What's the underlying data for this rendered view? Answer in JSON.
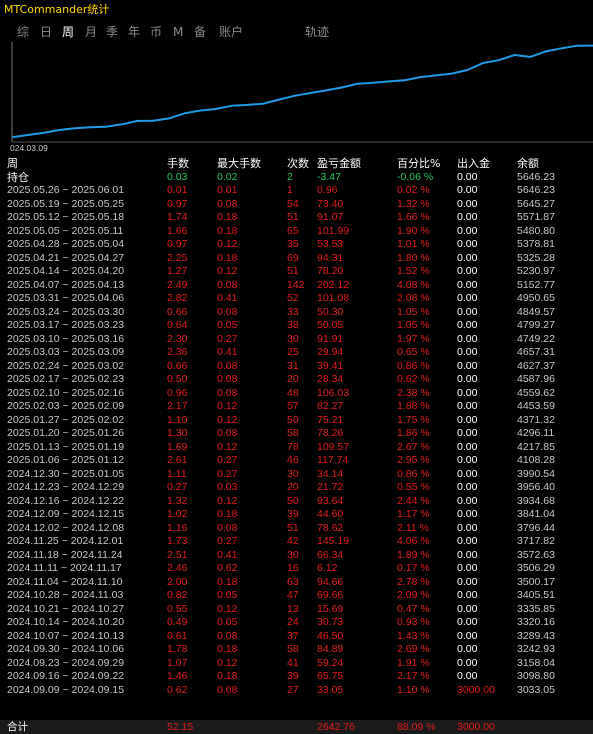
{
  "window": {
    "title": "MTCommander统计"
  },
  "tabs": [
    {
      "label": "综",
      "active": false
    },
    {
      "label": "日",
      "active": false
    },
    {
      "label": "周",
      "active": true
    },
    {
      "label": "月",
      "active": false
    },
    {
      "label": "季",
      "active": false
    },
    {
      "label": "年",
      "active": false
    },
    {
      "label": "币",
      "active": false
    },
    {
      "label": "M",
      "active": false
    },
    {
      "label": "备",
      "active": false
    },
    {
      "label": "账户",
      "active": false
    },
    {
      "label": "轨迹",
      "active": false
    }
  ],
  "chart_data": {
    "type": "line",
    "x_tick_label": "024.03.09",
    "line_color": "#1e9be6",
    "ylim": [
      2900,
      5750
    ],
    "values": [
      3033.05,
      3098.8,
      3158.04,
      3242.93,
      3289.43,
      3320.16,
      3335.85,
      3405.51,
      3500.17,
      3506.29,
      3572.63,
      3717.82,
      3796.44,
      3841.04,
      3934.68,
      3956.4,
      3990.54,
      4108.28,
      4217.85,
      4296.11,
      4371.32,
      4453.59,
      4559.62,
      4587.96,
      4627.37,
      4657.31,
      4749.22,
      4799.27,
      4849.57,
      4950.65,
      5152.77,
      5230.97,
      5378.81,
      5325.28,
      5480.8,
      5571.87,
      5645.27,
      5646.23
    ]
  },
  "table": {
    "headers": [
      "周",
      "手数",
      "最大手数",
      "次数",
      "盈亏金额",
      "百分比%",
      "出入金",
      "余额"
    ],
    "holding": [
      "持仓",
      "0.03",
      "0.02",
      "2",
      "-3.47",
      "-0.06 %",
      "0.00",
      "5646.23"
    ],
    "rows": [
      [
        "2025.05.26 ~ 2025.06.01",
        "0.01",
        "0.01",
        "1",
        "0.96",
        "0.02 %",
        "0.00",
        "5646.23"
      ],
      [
        "2025.05.19 ~ 2025.05.25",
        "0.97",
        "0.08",
        "54",
        "73.40",
        "1.32 %",
        "0.00",
        "5645.27"
      ],
      [
        "2025.05.12 ~ 2025.05.18",
        "1.74",
        "0.18",
        "51",
        "91.07",
        "1.66 %",
        "0.00",
        "5571.87"
      ],
      [
        "2025.05.05 ~ 2025.05.11",
        "1.66",
        "0.18",
        "65",
        "101.99",
        "1.90 %",
        "0.00",
        "5480.80"
      ],
      [
        "2025.04.28 ~ 2025.05.04",
        "0.97",
        "0.12",
        "35",
        "53.53",
        "1.01 %",
        "0.00",
        "5378.81"
      ],
      [
        "2025.04.21 ~ 2025.04.27",
        "2.25",
        "0.18",
        "69",
        "94.31",
        "1.80 %",
        "0.00",
        "5325.28"
      ],
      [
        "2025.04.14 ~ 2025.04.20",
        "1.27",
        "0.12",
        "51",
        "78.20",
        "1.52 %",
        "0.00",
        "5230.97"
      ],
      [
        "2025.04.07 ~ 2025.04.13",
        "2.49",
        "0.08",
        "142",
        "202.12",
        "4.08 %",
        "0.00",
        "5152.77"
      ],
      [
        "2025.03.31 ~ 2025.04.06",
        "2.82",
        "0.41",
        "52",
        "101.08",
        "2.08 %",
        "0.00",
        "4950.65"
      ],
      [
        "2025.03.24 ~ 2025.03.30",
        "0.66",
        "0.08",
        "33",
        "50.30",
        "1.05 %",
        "0.00",
        "4849.57"
      ],
      [
        "2025.03.17 ~ 2025.03.23",
        "0.64",
        "0.05",
        "38",
        "50.05",
        "1.05 %",
        "0.00",
        "4799.27"
      ],
      [
        "2025.03.10 ~ 2025.03.16",
        "2.30",
        "0.27",
        "30",
        "91.91",
        "1.97 %",
        "0.00",
        "4749.22"
      ],
      [
        "2025.03.03 ~ 2025.03.09",
        "2.36",
        "0.41",
        "25",
        "29.94",
        "0.65 %",
        "0.00",
        "4657.31"
      ],
      [
        "2025.02.24 ~ 2025.03.02",
        "0.66",
        "0.08",
        "31",
        "39.41",
        "0.86 %",
        "0.00",
        "4627.37"
      ],
      [
        "2025.02.17 ~ 2025.02.23",
        "0.50",
        "0.08",
        "20",
        "28.34",
        "0.62 %",
        "0.00",
        "4587.96"
      ],
      [
        "2025.02.10 ~ 2025.02.16",
        "0.96",
        "0.08",
        "48",
        "106.03",
        "2.38 %",
        "0.00",
        "4559.62"
      ],
      [
        "2025.02.03 ~ 2025.02.09",
        "2.17",
        "0.12",
        "57",
        "82.27",
        "1.88 %",
        "0.00",
        "4453.59"
      ],
      [
        "2025.01.27 ~ 2025.02.02",
        "1.10",
        "0.12",
        "50",
        "75.21",
        "1.75 %",
        "0.00",
        "4371.32"
      ],
      [
        "2025.01.20 ~ 2025.01.26",
        "1.30",
        "0.08",
        "58",
        "78.26",
        "1.86 %",
        "0.00",
        "4296.11"
      ],
      [
        "2025.01.13 ~ 2025.01.19",
        "1.69",
        "0.12",
        "78",
        "109.57",
        "2.67 %",
        "0.00",
        "4217.85"
      ],
      [
        "2025.01.06 ~ 2025.01.12",
        "2.61",
        "0.27",
        "46",
        "117.74",
        "2.95 %",
        "0.00",
        "4108.28"
      ],
      [
        "2024.12.30 ~ 2025.01.05",
        "1.11",
        "0.27",
        "30",
        "34.14",
        "0.86 %",
        "0.00",
        "3990.54"
      ],
      [
        "2024.12.23 ~ 2024.12.29",
        "0.27",
        "0.03",
        "20",
        "21.72",
        "0.55 %",
        "0.00",
        "3956.40"
      ],
      [
        "2024.12.16 ~ 2024.12.22",
        "1.32",
        "0.12",
        "50",
        "93.64",
        "2.44 %",
        "0.00",
        "3934.68"
      ],
      [
        "2024.12.09 ~ 2024.12.15",
        "1.02",
        "0.18",
        "39",
        "44.60",
        "1.17 %",
        "0.00",
        "3841.04"
      ],
      [
        "2024.12.02 ~ 2024.12.08",
        "1.16",
        "0.08",
        "51",
        "78.62",
        "2.11 %",
        "0.00",
        "3796.44"
      ],
      [
        "2024.11.25 ~ 2024.12.01",
        "1.73",
        "0.27",
        "42",
        "145.19",
        "4.06 %",
        "0.00",
        "3717.82"
      ],
      [
        "2024.11.18 ~ 2024.11.24",
        "2.51",
        "0.41",
        "30",
        "66.34",
        "1.89 %",
        "0.00",
        "3572.63"
      ],
      [
        "2024.11.11 ~ 2024.11.17",
        "2.46",
        "0.62",
        "16",
        "6.12",
        "0.17 %",
        "0.00",
        "3506.29"
      ],
      [
        "2024.11.04 ~ 2024.11.10",
        "2.00",
        "0.18",
        "63",
        "94.66",
        "2.78 %",
        "0.00",
        "3500.17"
      ],
      [
        "2024.10.28 ~ 2024.11.03",
        "0.82",
        "0.05",
        "47",
        "69.66",
        "2.09 %",
        "0.00",
        "3405.51"
      ],
      [
        "2024.10.21 ~ 2024.10.27",
        "0.55",
        "0.12",
        "13",
        "15.69",
        "0.47 %",
        "0.00",
        "3335.85"
      ],
      [
        "2024.10.14 ~ 2024.10.20",
        "0.49",
        "0.05",
        "24",
        "30.73",
        "0.93 %",
        "0.00",
        "3320.16"
      ],
      [
        "2024.10.07 ~ 2024.10.13",
        "0.61",
        "0.08",
        "37",
        "46.50",
        "1.43 %",
        "0.00",
        "3289.43"
      ],
      [
        "2024.09.30 ~ 2024.10.06",
        "1.78",
        "0.18",
        "58",
        "84.89",
        "2.69 %",
        "0.00",
        "3242.93"
      ],
      [
        "2024.09.23 ~ 2024.09.29",
        "1.07",
        "0.12",
        "41",
        "59.24",
        "1.91 %",
        "0.00",
        "3158.04"
      ],
      [
        "2024.09.16 ~ 2024.09.22",
        "1.46",
        "0.18",
        "39",
        "65.75",
        "2.17 %",
        "0.00",
        "3098.80"
      ],
      [
        "2024.09.09 ~ 2024.09.15",
        "0.62",
        "0.08",
        "27",
        "33.05",
        "1.10 %",
        "3000.00",
        "3033.05"
      ]
    ],
    "total": [
      "合计",
      "52.15",
      "2642.76",
      "88.09 %",
      "3000.00"
    ]
  }
}
